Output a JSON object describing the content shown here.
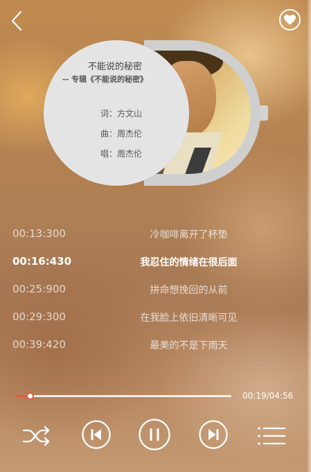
{
  "song": {
    "title": "不能说的秘密",
    "album_line": "-- 专辑《不能说的秘密》",
    "lyricist": "词：方文山",
    "composer": "曲：周杰伦",
    "singer": "唱：周杰伦"
  },
  "lyrics": [
    {
      "time": "00:13:300",
      "text": "冷咖啡离开了杯垫",
      "active": false
    },
    {
      "time": "00:16:430",
      "text": "我忍住的情绪在很后面",
      "active": true
    },
    {
      "time": "00:25:900",
      "text": "拼命想挽回的从前",
      "active": false
    },
    {
      "time": "00:29:300",
      "text": "在我脸上依旧清晰可见",
      "active": false
    },
    {
      "time": "00:39:420",
      "text": "最美的不是下雨天",
      "active": false
    }
  ],
  "player": {
    "time_display": "00:19/04:56",
    "progress": 0.066,
    "accent_color": "#e35b40"
  },
  "icons": {
    "back": "chevron-left-icon",
    "favorite": "heart-icon",
    "shuffle": "shuffle-icon",
    "previous": "skip-previous-icon",
    "pause": "pause-icon",
    "next": "skip-next-icon",
    "playlist": "playlist-icon"
  }
}
